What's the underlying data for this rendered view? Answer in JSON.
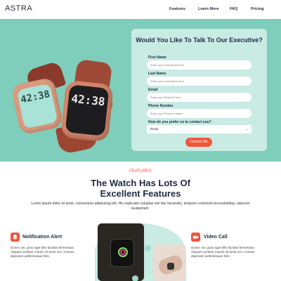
{
  "nav": {
    "logo": "ASTRA",
    "links": [
      {
        "label": "Features"
      },
      {
        "label": "Learn More"
      },
      {
        "label": "FAQ"
      },
      {
        "label": "Pricing"
      }
    ]
  },
  "hero": {
    "watch_left_time": "42:38",
    "watch_right_time": "42:38",
    "background": "#7fcdbb"
  },
  "form": {
    "title": "Would You Like To Talk To Our Executive?",
    "first_name_label": "First Name",
    "first_name_placeholder": "Enter your First Name here",
    "last_name_label": "Last Name",
    "last_name_placeholder": "Enter your Last Name here",
    "email_label": "Email",
    "email_placeholder": "Enter your Email ID here",
    "phone_label": "Phone Number",
    "phone_placeholder": "Enter your Phone number",
    "contact_pref_label": "How do you prefer us to contact you?",
    "contact_pref_value": "Email",
    "submit_label": "Contact Me"
  },
  "features": {
    "eyebrow": "FEATURES",
    "title": "The Watch Has Lots Of Excellent Features",
    "description": "Lorem ipsum dolor sit amet, consectetur adipisicing elit. Hic explicabo voluptas nisi iste reiciendis, tempore commodi necessitatibus, laborum laudantium.",
    "items": [
      {
        "name": "Notification Alert",
        "icon": "bell-icon",
        "text": "Donec nec justo eget felis facilisis fermentum. Aliquam porttitor mauris sit amet orci. Aenean dignissim pellentesque felis."
      },
      {
        "name": "Video Call",
        "icon": "video-icon",
        "text": "Donec nec justo eget felis facilisis fermentum. Aliquam porttitor mauris sit amet orci. Aenean dignissim pellentesque felis."
      }
    ]
  },
  "colors": {
    "accent": "#f0553b",
    "mint": "#7fcdbb",
    "navy": "#1f2a44"
  }
}
